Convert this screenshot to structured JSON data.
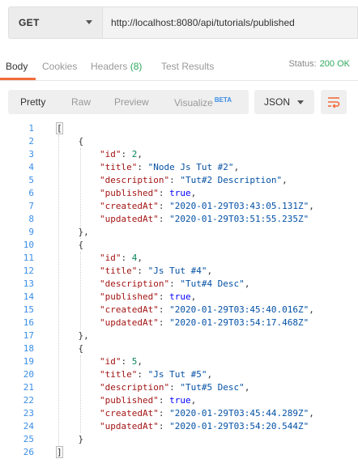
{
  "request": {
    "method": "GET",
    "url": "http://localhost:8080/api/tutorials/published"
  },
  "response_tabs": {
    "body": "Body",
    "cookies": "Cookies",
    "headers": "Headers",
    "headers_count": "(8)",
    "test_results": "Test Results"
  },
  "status": {
    "label": "Status:",
    "value": "200 OK"
  },
  "view_modes": {
    "pretty": "Pretty",
    "raw": "Raw",
    "preview": "Preview",
    "visualize": "Visualize",
    "beta": "BETA"
  },
  "format": "JSON",
  "icons": {
    "method_dropdown": "chevron-down-icon",
    "format_dropdown": "chevron-down-icon",
    "wrap": "wrap-lines-icon"
  },
  "colors": {
    "accent": "#f26b3a",
    "status_ok": "#2da85d",
    "line_numbers": "#3a8ee6"
  },
  "code_lines": [
    [
      [
        "p",
        "["
      ]
    ],
    [
      [
        "p",
        "    {"
      ]
    ],
    [
      [
        "p",
        "        "
      ],
      [
        "k",
        "\"id\""
      ],
      [
        "p",
        ": "
      ],
      [
        "n",
        "2"
      ],
      [
        "p",
        ","
      ]
    ],
    [
      [
        "p",
        "        "
      ],
      [
        "k",
        "\"title\""
      ],
      [
        "p",
        ": "
      ],
      [
        "s",
        "\"Node Js Tut #2\""
      ],
      [
        "p",
        ","
      ]
    ],
    [
      [
        "p",
        "        "
      ],
      [
        "k",
        "\"description\""
      ],
      [
        "p",
        ": "
      ],
      [
        "s",
        "\"Tut#2 Description\""
      ],
      [
        "p",
        ","
      ]
    ],
    [
      [
        "p",
        "        "
      ],
      [
        "k",
        "\"published\""
      ],
      [
        "p",
        ": "
      ],
      [
        "b",
        "true"
      ],
      [
        "p",
        ","
      ]
    ],
    [
      [
        "p",
        "        "
      ],
      [
        "k",
        "\"createdAt\""
      ],
      [
        "p",
        ": "
      ],
      [
        "s",
        "\"2020-01-29T03:43:05.131Z\""
      ],
      [
        "p",
        ","
      ]
    ],
    [
      [
        "p",
        "        "
      ],
      [
        "k",
        "\"updatedAt\""
      ],
      [
        "p",
        ": "
      ],
      [
        "s",
        "\"2020-01-29T03:51:55.235Z\""
      ]
    ],
    [
      [
        "p",
        "    },"
      ]
    ],
    [
      [
        "p",
        "    {"
      ]
    ],
    [
      [
        "p",
        "        "
      ],
      [
        "k",
        "\"id\""
      ],
      [
        "p",
        ": "
      ],
      [
        "n",
        "4"
      ],
      [
        "p",
        ","
      ]
    ],
    [
      [
        "p",
        "        "
      ],
      [
        "k",
        "\"title\""
      ],
      [
        "p",
        ": "
      ],
      [
        "s",
        "\"Js Tut #4\""
      ],
      [
        "p",
        ","
      ]
    ],
    [
      [
        "p",
        "        "
      ],
      [
        "k",
        "\"description\""
      ],
      [
        "p",
        ": "
      ],
      [
        "s",
        "\"Tut#4 Desc\""
      ],
      [
        "p",
        ","
      ]
    ],
    [
      [
        "p",
        "        "
      ],
      [
        "k",
        "\"published\""
      ],
      [
        "p",
        ": "
      ],
      [
        "b",
        "true"
      ],
      [
        "p",
        ","
      ]
    ],
    [
      [
        "p",
        "        "
      ],
      [
        "k",
        "\"createdAt\""
      ],
      [
        "p",
        ": "
      ],
      [
        "s",
        "\"2020-01-29T03:45:40.016Z\""
      ],
      [
        "p",
        ","
      ]
    ],
    [
      [
        "p",
        "        "
      ],
      [
        "k",
        "\"updatedAt\""
      ],
      [
        "p",
        ": "
      ],
      [
        "s",
        "\"2020-01-29T03:54:17.468Z\""
      ]
    ],
    [
      [
        "p",
        "    },"
      ]
    ],
    [
      [
        "p",
        "    {"
      ]
    ],
    [
      [
        "p",
        "        "
      ],
      [
        "k",
        "\"id\""
      ],
      [
        "p",
        ": "
      ],
      [
        "n",
        "5"
      ],
      [
        "p",
        ","
      ]
    ],
    [
      [
        "p",
        "        "
      ],
      [
        "k",
        "\"title\""
      ],
      [
        "p",
        ": "
      ],
      [
        "s",
        "\"Js Tut #5\""
      ],
      [
        "p",
        ","
      ]
    ],
    [
      [
        "p",
        "        "
      ],
      [
        "k",
        "\"description\""
      ],
      [
        "p",
        ": "
      ],
      [
        "s",
        "\"Tut#5 Desc\""
      ],
      [
        "p",
        ","
      ]
    ],
    [
      [
        "p",
        "        "
      ],
      [
        "k",
        "\"published\""
      ],
      [
        "p",
        ": "
      ],
      [
        "b",
        "true"
      ],
      [
        "p",
        ","
      ]
    ],
    [
      [
        "p",
        "        "
      ],
      [
        "k",
        "\"createdAt\""
      ],
      [
        "p",
        ": "
      ],
      [
        "s",
        "\"2020-01-29T03:45:44.289Z\""
      ],
      [
        "p",
        ","
      ]
    ],
    [
      [
        "p",
        "        "
      ],
      [
        "k",
        "\"updatedAt\""
      ],
      [
        "p",
        ": "
      ],
      [
        "s",
        "\"2020-01-29T03:54:20.544Z\""
      ]
    ],
    [
      [
        "p",
        "    }"
      ]
    ],
    [
      [
        "p",
        "]"
      ]
    ]
  ]
}
